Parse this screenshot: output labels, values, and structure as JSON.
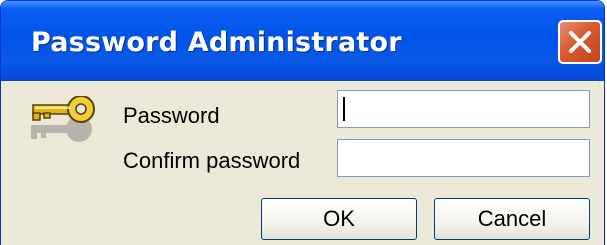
{
  "window": {
    "title": "Password Administrator",
    "close_icon": "close-x-icon"
  },
  "form": {
    "icon": "key-icon",
    "password_label": "Password",
    "password_value": "",
    "confirm_label": "Confirm password",
    "confirm_value": ""
  },
  "buttons": {
    "ok_label": "OK",
    "cancel_label": "Cancel"
  },
  "colors": {
    "titlebar": "#0053e8",
    "close_button": "#d85a2f",
    "dialog_face": "#ece9d8",
    "field_border": "#7f9db9"
  }
}
